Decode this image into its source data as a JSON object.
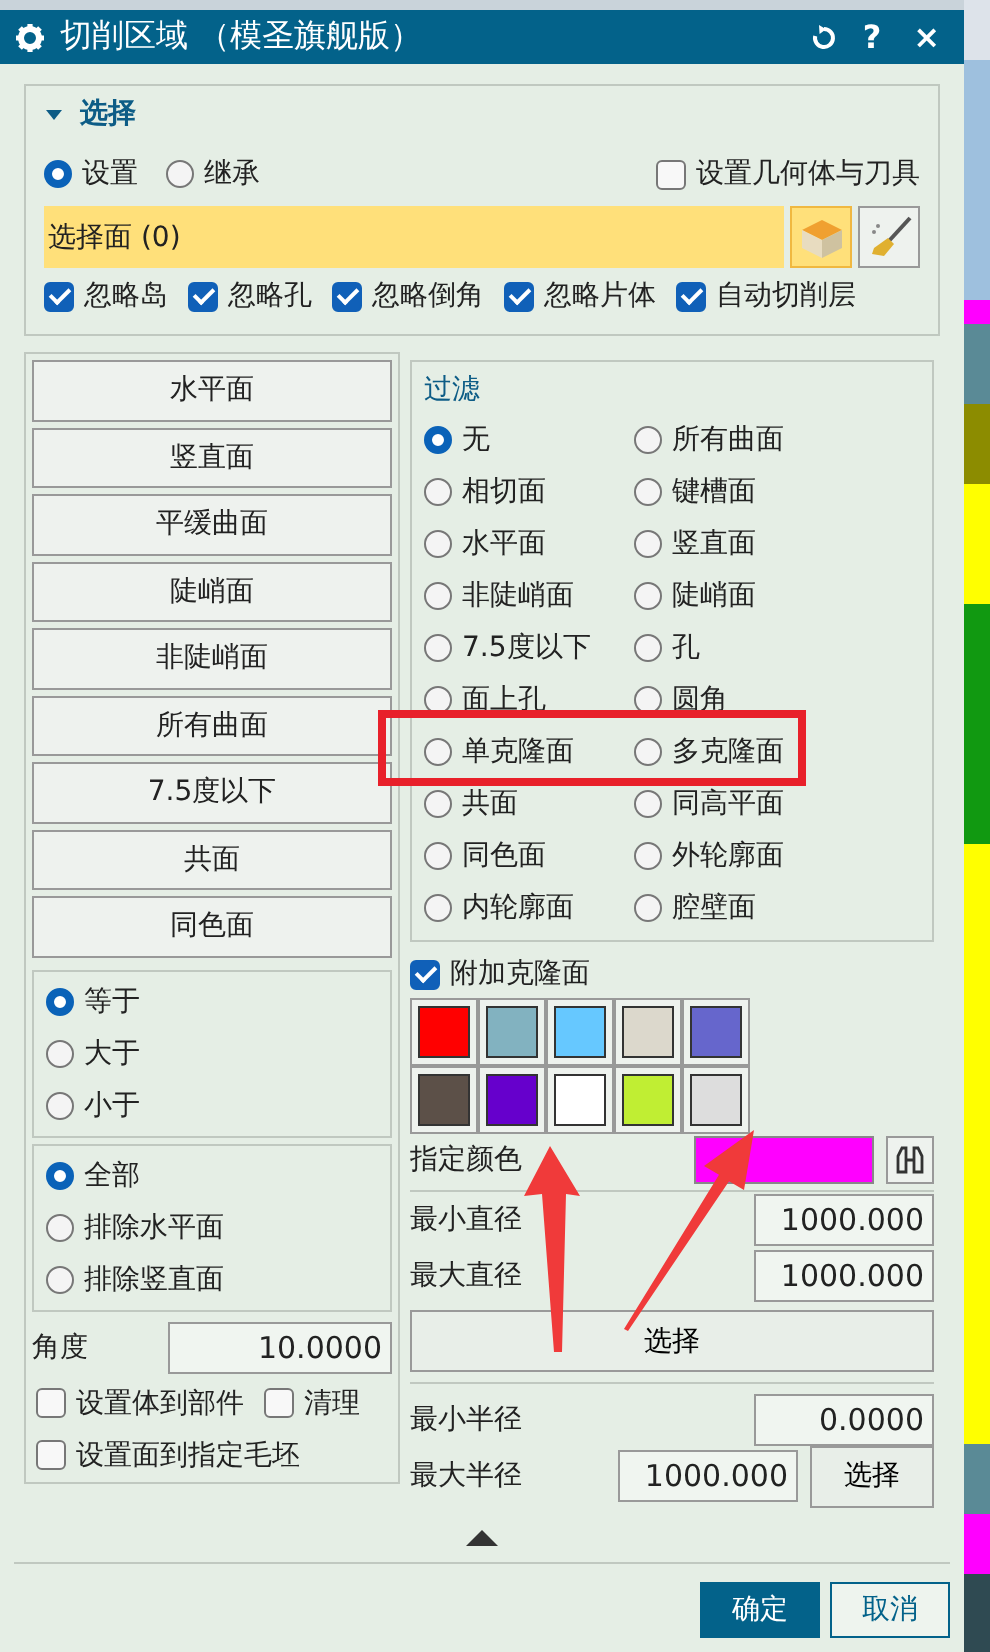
{
  "window": {
    "title": "切削区域 （模圣旗舰版）",
    "controls": [
      "?",
      "×"
    ]
  },
  "selection": {
    "title": "选择",
    "expanded": true,
    "modes": [
      {
        "label": "设置",
        "selected": true
      },
      {
        "label": "继承",
        "selected": false
      }
    ],
    "set_geometry": {
      "label": "设置几何体与刀具",
      "checked": false
    },
    "select_face": {
      "label": "选择面 (0)"
    },
    "options": [
      {
        "label": "忽略岛",
        "checked": true
      },
      {
        "label": "忽略孔",
        "checked": true
      },
      {
        "label": "忽略倒角",
        "checked": true
      },
      {
        "label": "忽略片体",
        "checked": true
      },
      {
        "label": "自动切削层",
        "checked": true
      }
    ]
  },
  "face_buttons": [
    "水平面",
    "竖直面",
    "平缓曲面",
    "陡峭面",
    "非陡峭面",
    "所有曲面",
    "7.5度以下",
    "共面",
    "同色面"
  ],
  "comparison": [
    {
      "label": "等于",
      "selected": true
    },
    {
      "label": "大于",
      "selected": false
    },
    {
      "label": "小于",
      "selected": false
    }
  ],
  "scope": [
    {
      "label": "全部",
      "selected": true
    },
    {
      "label": "排除水平面",
      "selected": false
    },
    {
      "label": "排除竖直面",
      "selected": false
    }
  ],
  "angle": {
    "label": "角度",
    "value": "10.0000"
  },
  "left_checks": [
    {
      "label": "设置体到部件",
      "checked": false
    },
    {
      "label": "清理",
      "checked": false
    },
    {
      "label": "设置面到指定毛坯",
      "checked": false
    }
  ],
  "filter": {
    "title": "过滤",
    "options": [
      {
        "label": "无",
        "selected": true
      },
      {
        "label": "所有曲面",
        "selected": false
      },
      {
        "label": "相切面",
        "selected": false
      },
      {
        "label": "键槽面",
        "selected": false
      },
      {
        "label": "水平面",
        "selected": false
      },
      {
        "label": "竖直面",
        "selected": false
      },
      {
        "label": "非陡峭面",
        "selected": false
      },
      {
        "label": "陡峭面",
        "selected": false
      },
      {
        "label": "7.5度以下",
        "selected": false
      },
      {
        "label": "孔",
        "selected": false
      },
      {
        "label": "面上孔",
        "selected": false
      },
      {
        "label": "圆角",
        "selected": false
      },
      {
        "label": "单克隆面",
        "selected": false
      },
      {
        "label": "多克隆面",
        "selected": false
      },
      {
        "label": "共面",
        "selected": false
      },
      {
        "label": "同高平面",
        "selected": false
      },
      {
        "label": "同色面",
        "selected": false
      },
      {
        "label": "外轮廓面",
        "selected": false
      },
      {
        "label": "内轮廓面",
        "selected": false
      },
      {
        "label": "腔壁面",
        "selected": false
      }
    ]
  },
  "clone": {
    "label": "附加克隆面",
    "checked": true,
    "swatches": [
      {
        "color": "#ff0000"
      },
      {
        "color": "#82b2c0"
      },
      {
        "color": "#66c8ff"
      },
      {
        "color": "#dcd8cc"
      },
      {
        "color": "#6666cc"
      },
      {
        "color": "#5c5048"
      },
      {
        "color": "#6600cc"
      },
      {
        "color": "#ffffff"
      },
      {
        "color": "#c0ee33"
      },
      {
        "color": "#dddddd"
      }
    ]
  },
  "specified_color": {
    "label": "指定颜色",
    "color": "#ff00ff"
  },
  "diameter": {
    "fields": [
      {
        "label": "最小直径",
        "value": "1000.000"
      },
      {
        "label": "最大直径",
        "value": "1000.000"
      }
    ],
    "button": "选择"
  },
  "radius": {
    "fields": [
      {
        "label": "最小半径",
        "value": "0.0000"
      },
      {
        "label": "最大半径",
        "value": "1000.000"
      }
    ],
    "button": "选择"
  },
  "buttons": [
    {
      "label": "确定",
      "kind": "primary"
    },
    {
      "label": "取消",
      "kind": "secondary"
    }
  ]
}
